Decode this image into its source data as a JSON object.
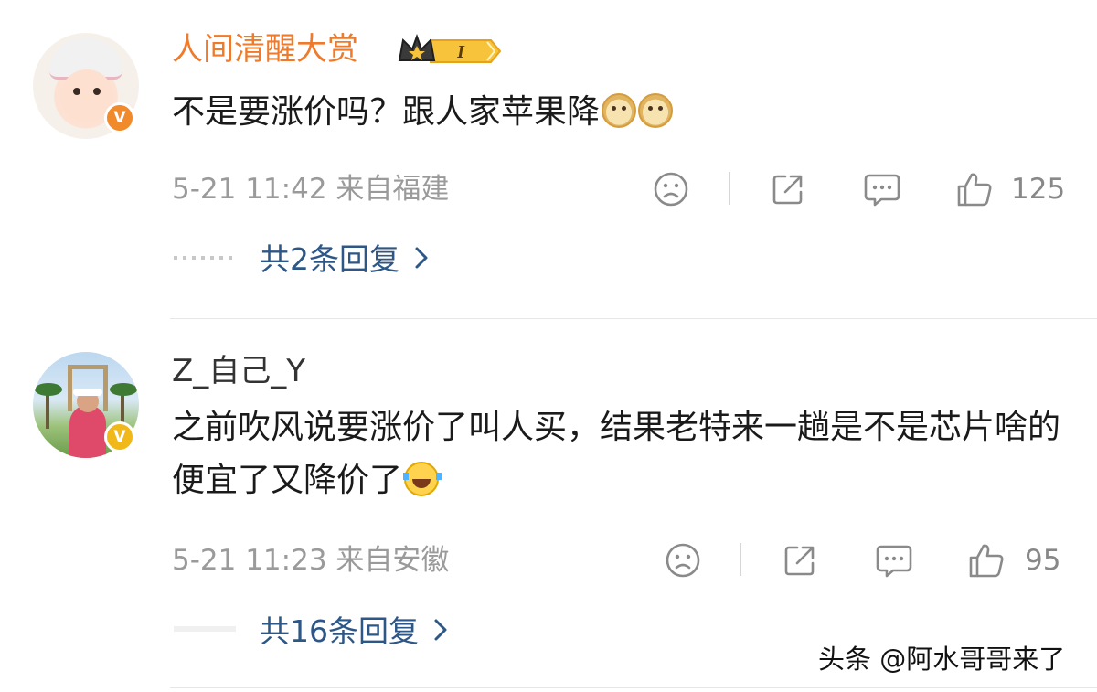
{
  "comments": [
    {
      "username": "人间清醒大赏",
      "level_badge": "I",
      "text": "不是要涨价吗？跟人家苹果降",
      "emojis": [
        "doge",
        "doge"
      ],
      "meta": "5-21 11:42  来自福建",
      "like_count": "125",
      "replies_label": "共2条回复"
    },
    {
      "username": "Z_自己_Y",
      "text": "之前吹风说要涨价了叫人买，结果老特来一趟是不是芯片啥的便宜了又降价了",
      "emojis": [
        "laugh-cry"
      ],
      "meta": "5-21 11:23  来自安徽",
      "like_count": "95",
      "replies_label": "共16条回复"
    }
  ],
  "watermark": "头条 @阿水哥哥来了",
  "verify_badge": "V",
  "colors": {
    "username_vip": "#ee7a2b",
    "link": "#2d5786",
    "meta": "#9a9a9a",
    "verify_orange": "#f08a2a",
    "verify_yellow": "#f1b81a"
  },
  "icons": [
    "dislike-face-icon",
    "share-icon",
    "comment-icon",
    "like-thumb-icon",
    "chevron-right-icon"
  ]
}
